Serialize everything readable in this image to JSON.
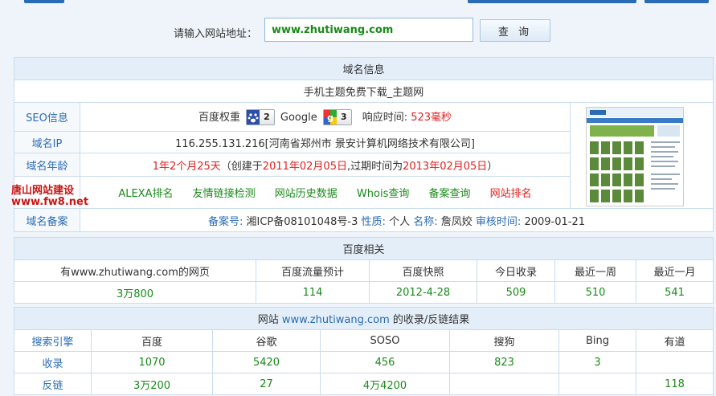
{
  "search": {
    "label": "请输入网站地址：",
    "value": "www.zhutiwang.com",
    "button": "查 询"
  },
  "domain_info": {
    "header": "域名信息",
    "site_title": "手机主题免费下载_主题网",
    "seo_label": "SEO信息",
    "baidu_weight_label": "百度权重",
    "baidu_weight": "2",
    "google_label": "Google",
    "google_pr": "3",
    "response_label": "响应时间:",
    "response_value": "523毫秒",
    "ip_label": "域名IP",
    "ip_value": "116.255.131.216[河南省郑州市 景安计算机网络技术有限公司]",
    "age_label": "域名年龄",
    "age_value": "1年2个月25天",
    "age_detail_1": "（创建于",
    "created": "2011年02月05日",
    "age_detail_2": ",过期时间为",
    "expires": "2013年02月05日",
    "age_detail_3": "）",
    "links": [
      "ALEXA排名",
      "友情链接检测",
      "网站历史数据",
      "Whois查询",
      "备案查询",
      "网站排名"
    ],
    "beian_label": "域名备案",
    "beian_no_label": "备案号:",
    "beian_no": "湘ICP备08101048号-3",
    "nature_label": "性质:",
    "nature": "个人",
    "name_label": "名称:",
    "name": "詹凤姣",
    "audit_label": "审核时间:",
    "audit": "2009-01-21"
  },
  "watermark": {
    "line1": "唐山网站建设",
    "line2": "www.fw8.net"
  },
  "baidu": {
    "header": "百度相关",
    "columns": [
      "有www.zhutiwang.com的网页",
      "百度流量预计",
      "百度快照",
      "今日收录",
      "最近一周",
      "最近一月"
    ],
    "values": [
      "3万800",
      "114",
      "2012-4-28",
      "509",
      "510",
      "541"
    ]
  },
  "index": {
    "header_prefix": "网站",
    "header_domain": "www.zhutiwang.com",
    "header_suffix": "的收录/反链结果",
    "columns": [
      "搜索引擎",
      "百度",
      "谷歌",
      "SOSO",
      "搜狗",
      "Bing",
      "有道"
    ],
    "rows": [
      {
        "label": "收录",
        "values": [
          "1070",
          "5420",
          "456",
          "823",
          "3",
          ""
        ]
      },
      {
        "label": "反链",
        "values": [
          "3万200",
          "27",
          "4万4200",
          "",
          "",
          "118"
        ]
      }
    ]
  },
  "colors": {
    "accent": "#2a6bb5",
    "green": "#1a8a1a",
    "red": "#e02020",
    "header_bg": "#e3eef9",
    "border": "#c9dcee"
  }
}
